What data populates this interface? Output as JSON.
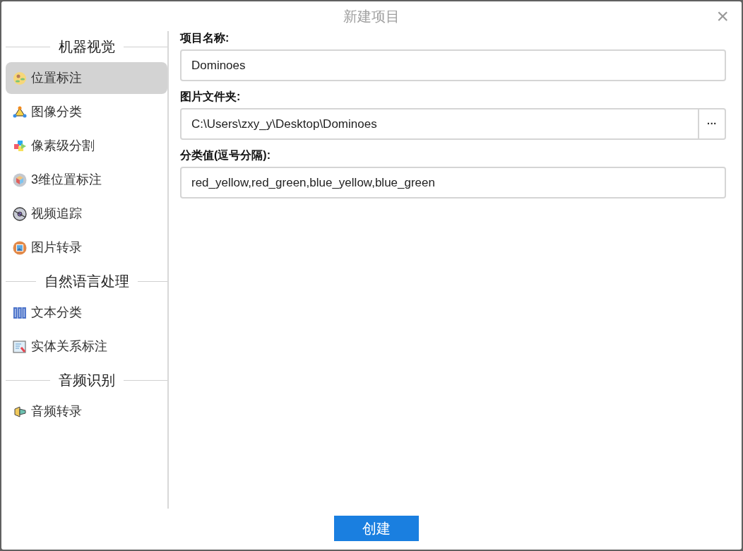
{
  "window": {
    "title": "新建项目",
    "close": "×"
  },
  "sidebar": {
    "groups": [
      {
        "title": "机器视觉",
        "items": [
          {
            "label": "位置标注",
            "kind": "people",
            "selected": true
          },
          {
            "label": "图像分类",
            "kind": "network",
            "selected": false
          },
          {
            "label": "像素级分割",
            "kind": "puzzle",
            "selected": false
          },
          {
            "label": "3维位置标注",
            "kind": "cube",
            "selected": false
          },
          {
            "label": "视频追踪",
            "kind": "disc",
            "selected": false
          },
          {
            "label": "图片转录",
            "kind": "picture",
            "selected": false
          }
        ]
      },
      {
        "title": "自然语言处理",
        "items": [
          {
            "label": "文本分类",
            "kind": "binders",
            "selected": false
          },
          {
            "label": "实体关系标注",
            "kind": "document",
            "selected": false
          }
        ]
      },
      {
        "title": "音频识别",
        "items": [
          {
            "label": "音频转录",
            "kind": "speaker",
            "selected": false
          }
        ]
      }
    ]
  },
  "form": {
    "fields": [
      {
        "label": "项目名称:",
        "value": "Dominoes"
      },
      {
        "label": "图片文件夹:",
        "value": "C:\\Users\\zxy_y\\Desktop\\Dominoes",
        "browse": "···"
      },
      {
        "label": "分类值(逗号分隔):",
        "value": "red_yellow,red_green,blue_yellow,blue_green"
      }
    ]
  },
  "create_button": "创建"
}
